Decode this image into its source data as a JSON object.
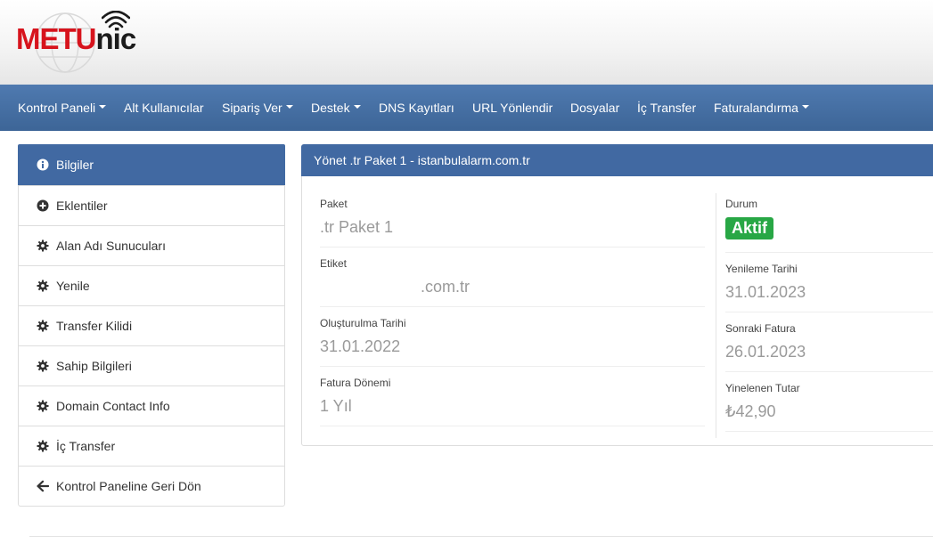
{
  "brand": {
    "part1": "METU",
    "part2": "nic"
  },
  "nav": [
    {
      "label": "Kontrol Paneli",
      "dropdown": true
    },
    {
      "label": "Alt Kullanıcılar",
      "dropdown": false
    },
    {
      "label": "Sipariş Ver",
      "dropdown": true
    },
    {
      "label": "Destek",
      "dropdown": true
    },
    {
      "label": "DNS Kayıtları",
      "dropdown": false
    },
    {
      "label": "URL Yönlendir",
      "dropdown": false
    },
    {
      "label": "Dosyalar",
      "dropdown": false
    },
    {
      "label": "İç Transfer",
      "dropdown": false
    },
    {
      "label": "Faturalandırma",
      "dropdown": true
    }
  ],
  "sidebar": {
    "items": [
      {
        "label": "Bilgiler",
        "icon": "info-icon",
        "active": true
      },
      {
        "label": "Eklentiler",
        "icon": "plus-circle-icon"
      },
      {
        "label": "Alan Adı Sunucuları",
        "icon": "gear-icon"
      },
      {
        "label": "Yenile",
        "icon": "gear-icon"
      },
      {
        "label": "Transfer Kilidi",
        "icon": "gear-icon"
      },
      {
        "label": "Sahip Bilgileri",
        "icon": "gear-icon"
      },
      {
        "label": "Domain Contact Info",
        "icon": "gear-icon"
      },
      {
        "label": "İç Transfer",
        "icon": "gear-icon"
      },
      {
        "label": "Kontrol Paneline Geri Dön",
        "icon": "arrow-left-icon"
      }
    ]
  },
  "panel": {
    "title": "Yönet .tr Paket 1 - istanbulalarm.com.tr",
    "left": [
      {
        "label": "Paket",
        "value": ".tr Paket 1"
      },
      {
        "label": "Etiket",
        "value": ".com.tr"
      },
      {
        "label": "Oluşturulma Tarihi",
        "value": "31.01.2022"
      },
      {
        "label": "Fatura Dönemi",
        "value": "1 Yıl"
      }
    ],
    "right": {
      "status_label": "Durum",
      "status_value": "Aktif",
      "fields": [
        {
          "label": "Yenileme Tarihi",
          "value": "31.01.2023"
        },
        {
          "label": "Sonraki Fatura",
          "value": "26.01.2023"
        },
        {
          "label": "Yinelenen Tutar",
          "value": "₺42,90"
        }
      ]
    }
  },
  "colors": {
    "nav_bg": "#4a74aa",
    "active_bg": "#4169a2",
    "status_green": "#28a745",
    "brand_red": "#d7141d"
  }
}
